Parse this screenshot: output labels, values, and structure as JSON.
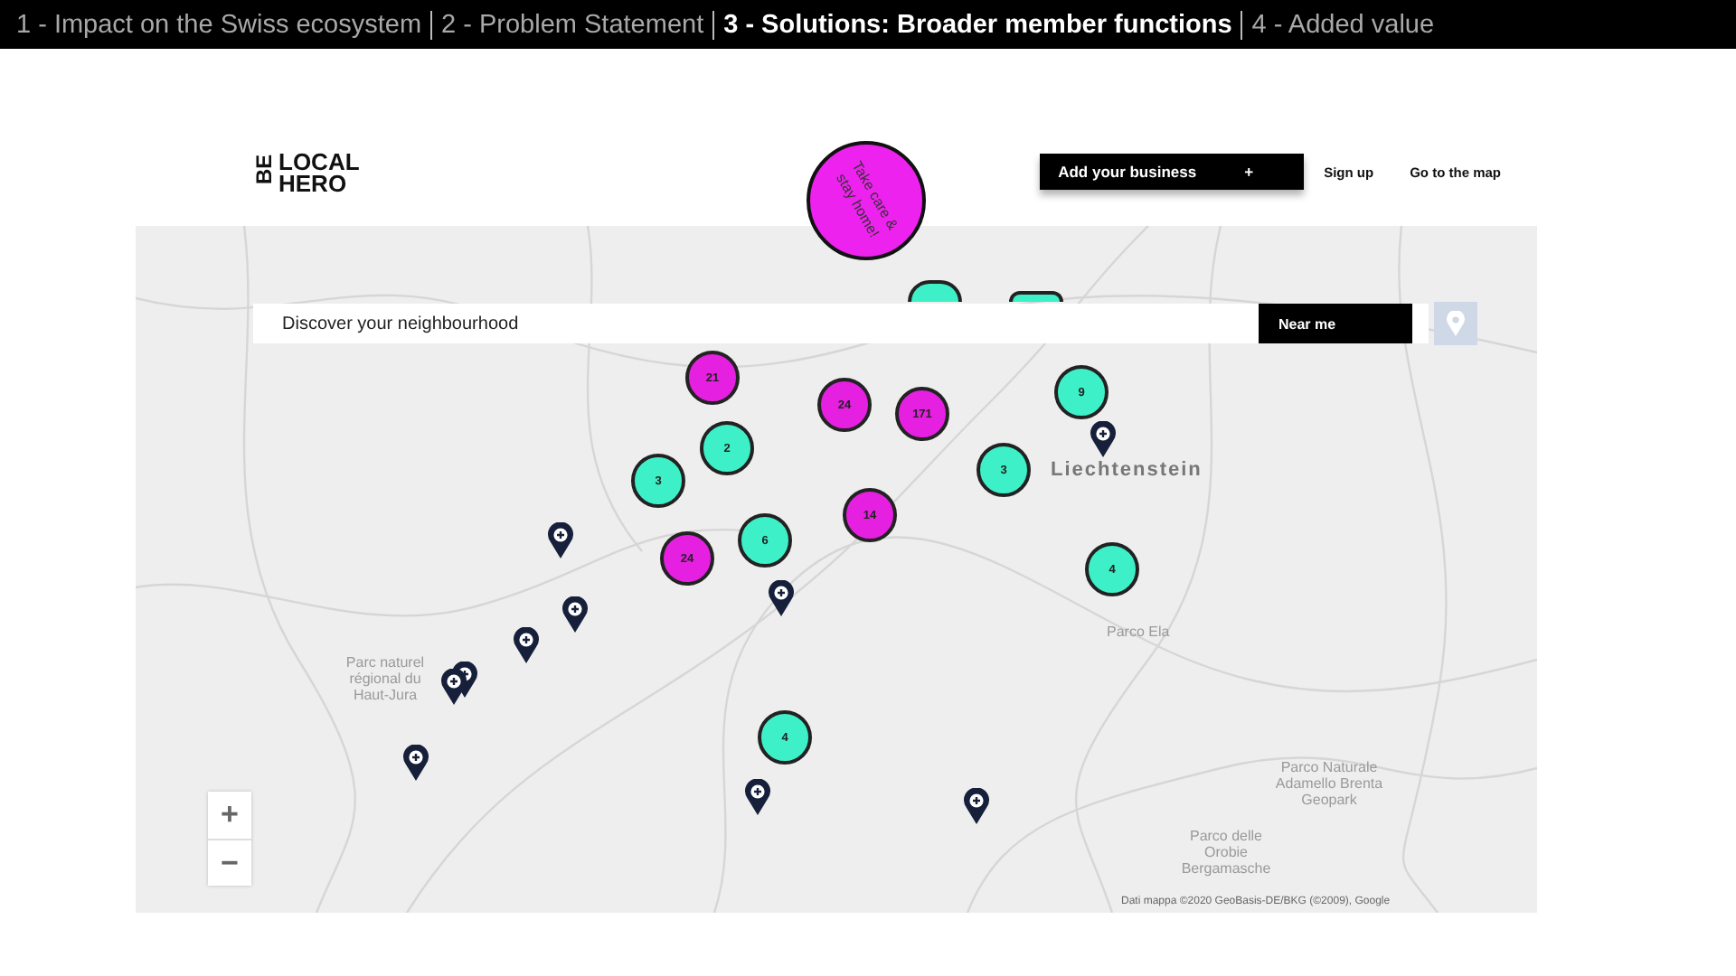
{
  "breadcrumb": [
    {
      "label": "1 - Impact on the Swiss ecosystem",
      "selected": false
    },
    {
      "label": "2 - Problem Statement",
      "selected": false
    },
    {
      "label": "3 - Solutions: Broader member functions",
      "selected": true
    },
    {
      "label": "4 - Added value",
      "selected": false
    }
  ],
  "site": {
    "logo": {
      "side": "BE",
      "lines": [
        "LOCAL",
        "HERO"
      ]
    },
    "badge": "Take care & stay home!",
    "add_button": {
      "label": "Add your business",
      "icon": "+"
    },
    "nav": [
      "Sign up",
      "Go to the map"
    ]
  },
  "search": {
    "placeholder": "Discover your neighbourhood",
    "button": "Near me"
  },
  "map": {
    "labels": [
      "Liechtenstein",
      "Parco Ela",
      "Parc naturel régional du Haut-Jura",
      "Parco Naturale Adamello Brenta Geopark",
      "Parco delle Orobie Bergamasche"
    ],
    "attribution": "Dati mappa ©2020 GeoBasis-DE/BKG (©2009), Google",
    "zoom": {
      "in": "+",
      "out": "−"
    },
    "clusters": [
      {
        "color": "#3ef0c8"
      },
      {
        "color": "#3ef0c8"
      },
      {
        "label": "21",
        "color": "#e520e0"
      },
      {
        "label": "24",
        "color": "#e520e0"
      },
      {
        "label": "171",
        "color": "#e520e0"
      },
      {
        "label": "9",
        "color": "#3ef0c8"
      },
      {
        "label": "2",
        "color": "#3ef0c8"
      },
      {
        "label": "3",
        "color": "#3ef0c8"
      },
      {
        "label": "3",
        "color": "#3ef0c8"
      },
      {
        "label": "14",
        "color": "#e520e0"
      },
      {
        "label": "6",
        "color": "#3ef0c8"
      },
      {
        "label": "24",
        "color": "#e520e0"
      },
      {
        "label": "4",
        "color": "#3ef0c8"
      },
      {
        "label": "4",
        "color": "#3ef0c8"
      }
    ]
  }
}
